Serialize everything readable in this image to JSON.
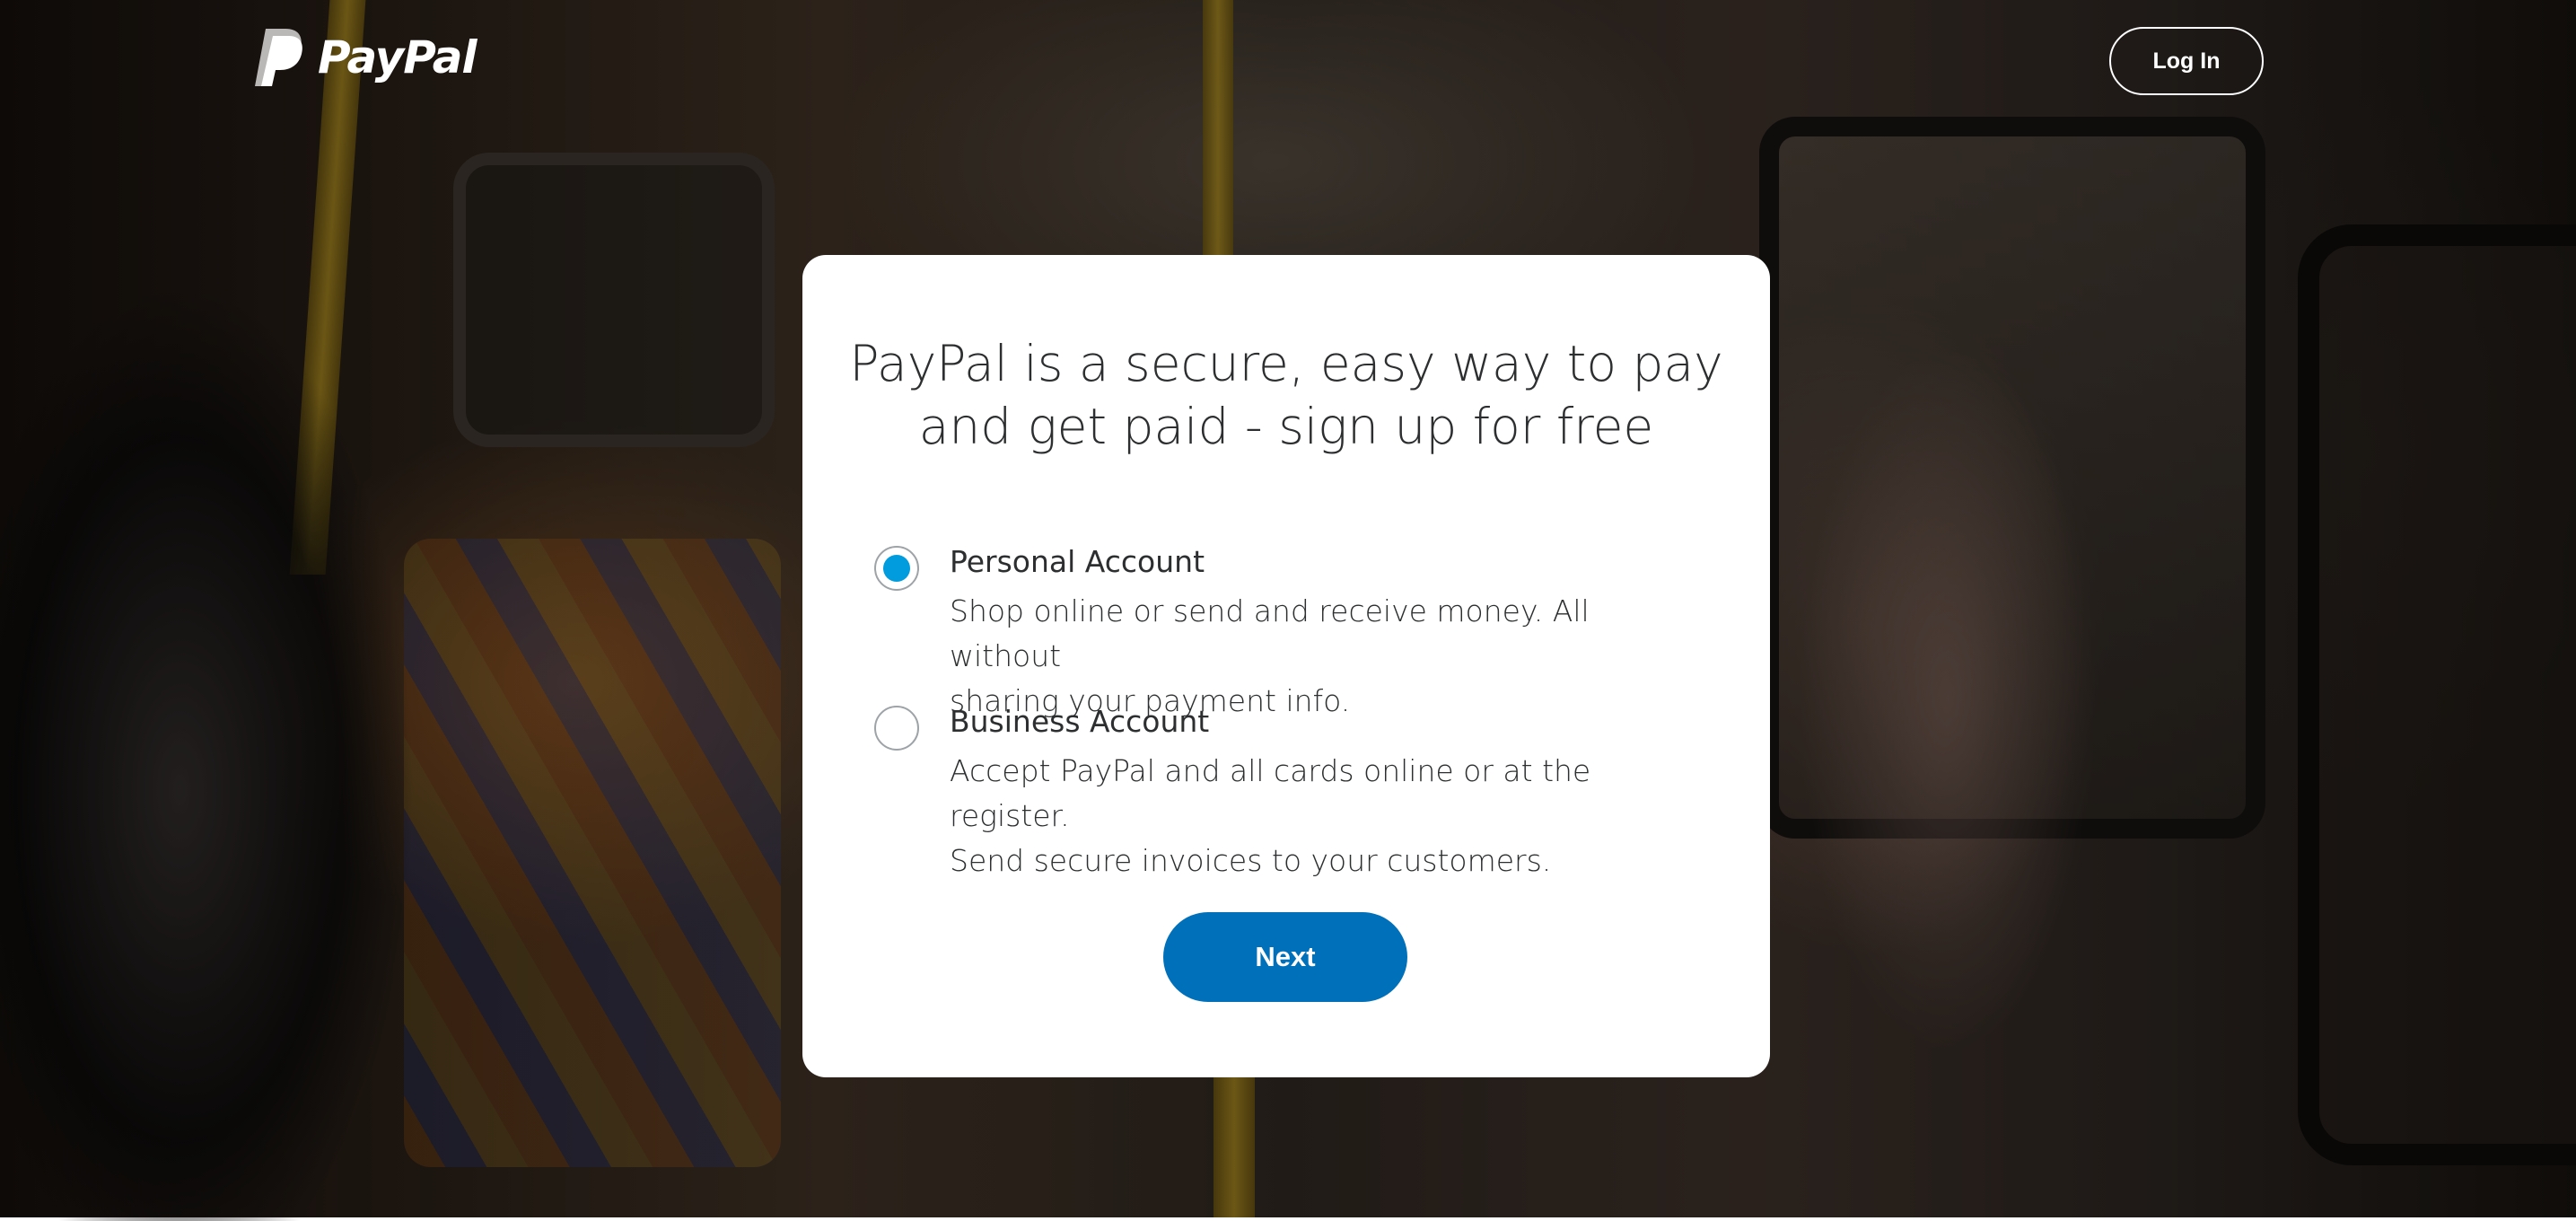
{
  "header": {
    "logo_text": "PayPal",
    "login_label": "Log In"
  },
  "card": {
    "title_line1": "PayPal is a secure, easy way to pay",
    "title_line2": "and get paid - sign up for free",
    "options": [
      {
        "title": "Personal Account",
        "desc_line1": "Shop online or send and receive money. All without",
        "desc_line2": "sharing your payment info.",
        "selected": true
      },
      {
        "title": "Business Account",
        "desc_line1": "Accept PayPal and all cards online or at the register.",
        "desc_line2": "Send secure invoices to your customers.",
        "selected": false
      }
    ],
    "next_label": "Next"
  },
  "icons": {
    "logo": "paypal-logo-icon",
    "radio_selected": "radio-selected-icon",
    "radio_unselected": "radio-unselected-icon"
  },
  "colors": {
    "primary_button": "#0070ba",
    "radio_accent": "#009cde",
    "card_background": "#ffffff",
    "text": "#2c2e2f"
  }
}
